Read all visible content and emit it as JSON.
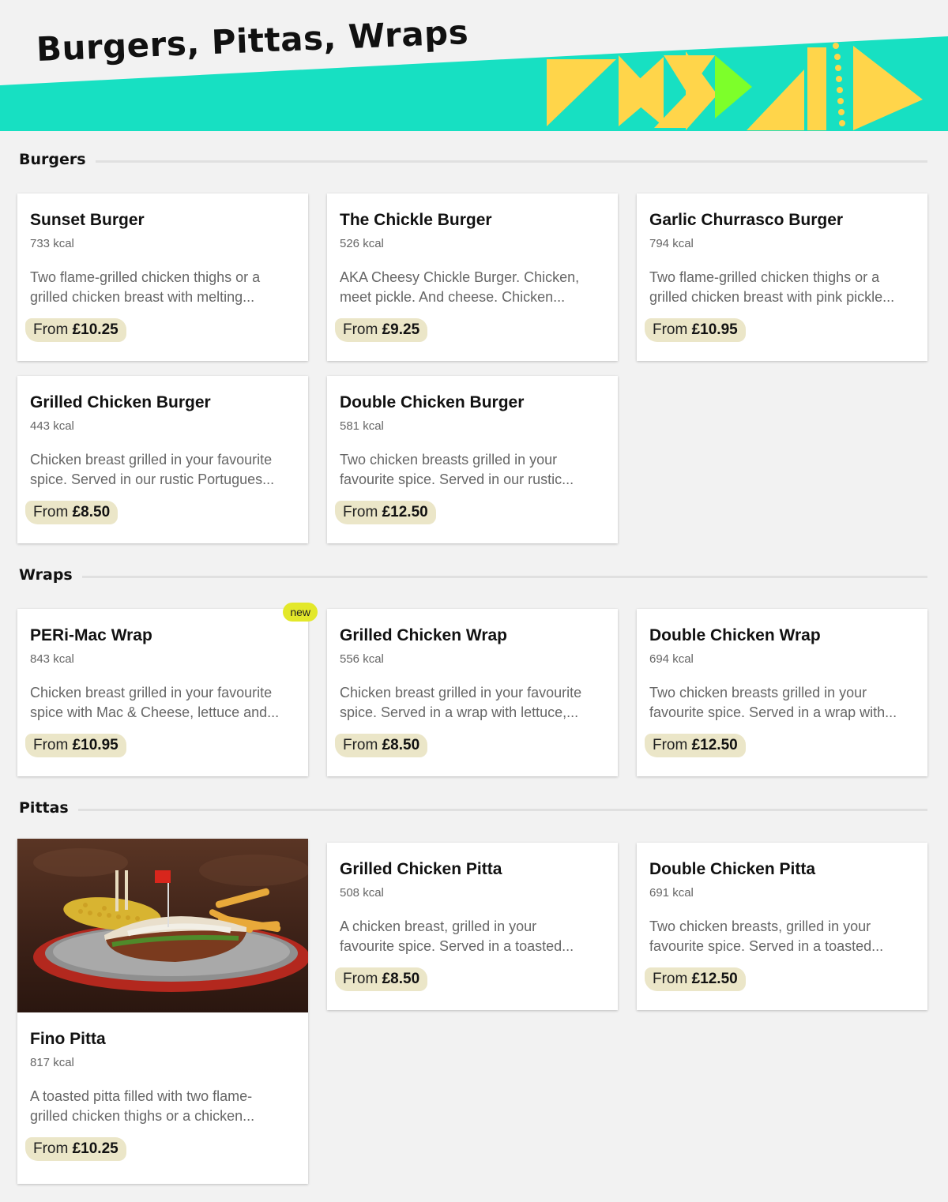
{
  "page": {
    "title": "Burgers, Pittas, Wraps"
  },
  "colors": {
    "banner": "#17e0c2",
    "triangles": "#ffd54a",
    "accent_green": "#7dff2a",
    "price_bg": "#ebe6c8",
    "badge": "#e3e82a"
  },
  "sections": [
    {
      "title": "Burgers",
      "items": [
        {
          "name": "Sunset Burger",
          "kcal": "733 kcal",
          "desc1": "Two flame-grilled chicken thighs or a",
          "desc2": "grilled chicken breast with melting...",
          "price_prefix": "From",
          "price": "£10.25"
        },
        {
          "name": "The Chickle Burger",
          "kcal": "526 kcal",
          "desc1": "AKA Cheesy Chickle Burger. Chicken,",
          "desc2": "meet pickle. And cheese. Chicken...",
          "price_prefix": "From",
          "price": "£9.25"
        },
        {
          "name": "Garlic Churrasco Burger",
          "kcal": "794 kcal",
          "desc1": "Two flame-grilled chicken thighs or a",
          "desc2": "grilled chicken breast with pink pickle...",
          "price_prefix": "From",
          "price": "£10.95"
        },
        {
          "name": "Grilled Chicken Burger",
          "kcal": "443 kcal",
          "desc1": "Chicken breast grilled in your favourite",
          "desc2": "spice. Served in our rustic Portugues...",
          "price_prefix": "From",
          "price": "£8.50"
        },
        {
          "name": "Double Chicken Burger",
          "kcal": "581 kcal",
          "desc1": "Two chicken breasts grilled in your",
          "desc2": "favourite spice. Served in our rustic...",
          "price_prefix": "From",
          "price": "£12.50"
        }
      ]
    },
    {
      "title": "Wraps",
      "items": [
        {
          "name": "PERi-Mac Wrap",
          "kcal": "843 kcal",
          "badge": "new",
          "desc1": "Chicken breast grilled in your favourite",
          "desc2": "spice with Mac & Cheese, lettuce and...",
          "price_prefix": "From",
          "price": "£10.95"
        },
        {
          "name": "Grilled Chicken Wrap",
          "kcal": "556 kcal",
          "desc1": "Chicken breast grilled in your favourite",
          "desc2": "spice. Served in a wrap with lettuce,...",
          "price_prefix": "From",
          "price": "£8.50"
        },
        {
          "name": "Double Chicken Wrap",
          "kcal": "694 kcal",
          "desc1": "Two chicken breasts grilled in your",
          "desc2": "favourite spice. Served in a wrap with...",
          "price_prefix": "From",
          "price": "£12.50"
        }
      ]
    },
    {
      "title": "Pittas",
      "items": [
        {
          "name": "Fino Pitta",
          "kcal": "817 kcal",
          "image": "pitta-plate-photo",
          "desc1": "A toasted pitta filled with two flame-",
          "desc2": "grilled chicken thighs or a chicken...",
          "price_prefix": "From",
          "price": "£10.25"
        },
        {
          "name": "Grilled Chicken Pitta",
          "kcal": "508 kcal",
          "desc1": "A chicken breast, grilled in your",
          "desc2": "favourite spice. Served in a toasted...",
          "price_prefix": "From",
          "price": "£8.50"
        },
        {
          "name": "Double Chicken Pitta",
          "kcal": "691 kcal",
          "desc1": "Two chicken breasts, grilled in your",
          "desc2": "favourite spice. Served in a toasted...",
          "price_prefix": "From",
          "price": "£12.50"
        }
      ]
    }
  ]
}
